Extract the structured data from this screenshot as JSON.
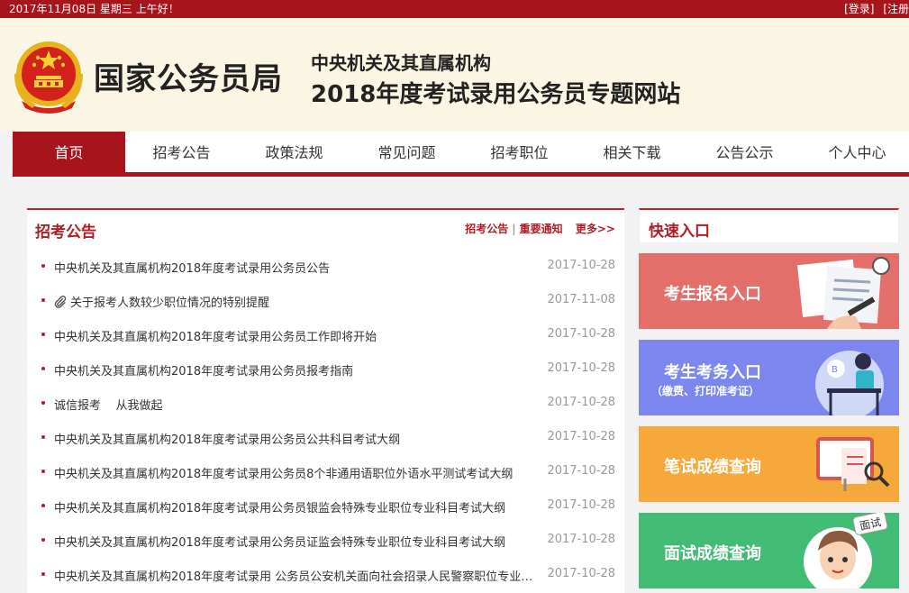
{
  "topbar": {
    "date": "2017年11月08日  星期三  上午好！",
    "login": "[登录]",
    "register": "[注册"
  },
  "header": {
    "title": "国家公务员局",
    "subtitle1": "中央机关及其直属机构",
    "subtitle2": "2018年度考试录用公务员专题网站"
  },
  "nav": [
    {
      "label": "首页"
    },
    {
      "label": "招考公告"
    },
    {
      "label": "政策法规"
    },
    {
      "label": "常见问题"
    },
    {
      "label": "招考职位"
    },
    {
      "label": "相关下载"
    },
    {
      "label": "公告公示"
    },
    {
      "label": "个人中心"
    }
  ],
  "announcements": {
    "title": "招考公告",
    "link1": "招考公告",
    "link2": "重要通知",
    "more": "更多>>",
    "items": [
      {
        "title": "中央机关及其直属机构2018年度考试录用公务员公告",
        "date": "2017-10-28"
      },
      {
        "title": "关于报考人数较少职位情况的特别提醒",
        "date": "2017-11-08",
        "attachment": true
      },
      {
        "title": "中央机关及其直属机构2018年度考试录用公务员工作即将开始",
        "date": "2017-10-28"
      },
      {
        "title": "中央机关及其直属机构2018年度考试录用公务员报考指南",
        "date": "2017-10-28"
      },
      {
        "title": "诚信报考    从我做起",
        "date": "2017-10-28"
      },
      {
        "title": "中央机关及其直属机构2018年度考试录用公务员公共科目考试大纲",
        "date": "2017-10-28"
      },
      {
        "title": "中央机关及其直属机构2018年度考试录用公务员8个非通用语职位外语水平测试考试大纲",
        "date": "2017-10-28"
      },
      {
        "title": "中央机关及其直属机构2018年度考试录用公务员银监会特殊专业职位专业科目考试大纲",
        "date": "2017-10-28"
      },
      {
        "title": "中央机关及其直属机构2018年度考试录用公务员证监会特殊专业职位专业科目考试大纲",
        "date": "2017-10-28"
      },
      {
        "title": "中央机关及其直属机构2018年度考试录用 公务员公安机关面向社会招录人民警察职位专业…",
        "date": "2017-10-28"
      }
    ]
  },
  "quick": {
    "title": "快速入口",
    "btn1": "考生报名入口",
    "btn2": "考生考务入口",
    "btn2_sub": "（缴费、打印准考证）",
    "btn3": "笔试成绩查询",
    "btn4": "面试成绩查询",
    "btn4_badge": "面试"
  },
  "colors": {
    "brand_red": "#a8141c",
    "q1": "#e46e6a",
    "q2": "#7b86ef",
    "q3": "#f6a93a",
    "q4": "#42bb75"
  }
}
